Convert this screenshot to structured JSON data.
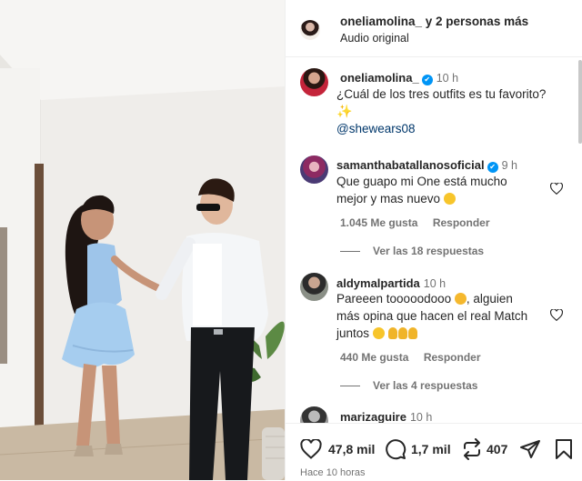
{
  "header": {
    "username": "oneliamolina_",
    "collab_suffix": " y 2 personas más",
    "audio": "Audio original"
  },
  "caption": {
    "username": "oneliamolina_",
    "time": "10 h",
    "text": "¿Cuál de los tres outfits es tu favorito?",
    "mention": "@shewears08"
  },
  "comments": [
    {
      "username": "samanthabatallanosoficial",
      "verified": true,
      "time": "9 h",
      "line1": "Que guapo mi One está mucho",
      "line2": "mejor y mas nuevo",
      "likes": "1.045 Me gusta",
      "reply": "Responder",
      "view_replies": "Ver las 18 respuestas"
    },
    {
      "username": "aldymalpartida",
      "verified": false,
      "time": "10 h",
      "line1": "Pareeen tooooodooo",
      "line1b": ", alguien",
      "line2": "más opina que hacen el real Match",
      "line3": "juntos",
      "likes": "440 Me gusta",
      "reply": "Responder",
      "view_replies": "Ver las 4 respuestas"
    },
    {
      "username": "marizaguire",
      "verified": false,
      "time": "10 h"
    }
  ],
  "actions": {
    "likes": "47,8 mil",
    "comments": "1,7 mil",
    "reposts": "407",
    "posted": "Hace 10 horas"
  },
  "colors": {
    "link": "#00376b",
    "verified": "#0095f6",
    "muted": "#737373"
  }
}
